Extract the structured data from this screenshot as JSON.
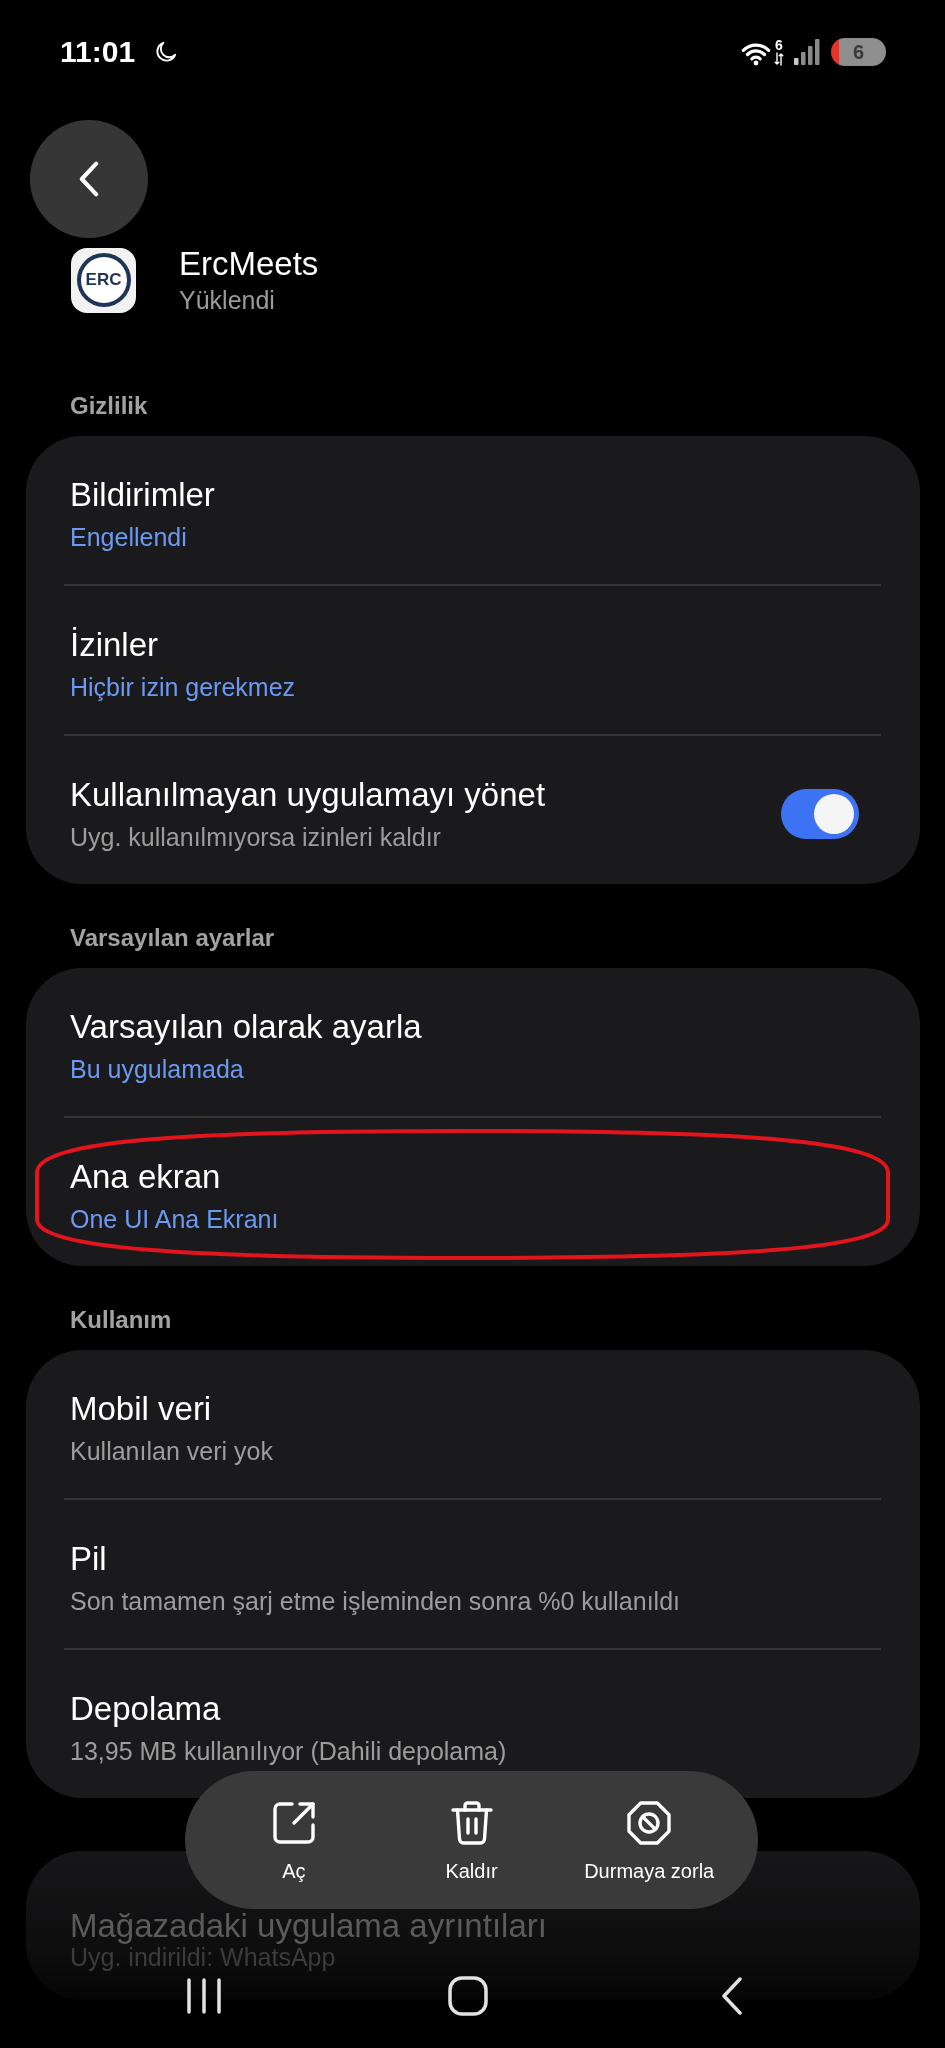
{
  "status_bar": {
    "time": "11:01",
    "wifi_standard": "6",
    "battery": "6"
  },
  "header": {
    "app_name": "ErcMeets",
    "app_status": "Yüklendi",
    "logo_text": "ERC"
  },
  "sections": [
    {
      "title": "Gizlilik",
      "faded": false,
      "items": [
        {
          "kind": "link",
          "title": "Bildirimler",
          "subtitle": "Engellendi",
          "accent": true,
          "circled": false
        },
        {
          "kind": "link",
          "title": "İzinler",
          "subtitle": "Hiçbir izin gerekmez",
          "accent": true,
          "circled": false
        },
        {
          "kind": "toggle",
          "title": "Kullanılmayan uygulamayı yönet",
          "subtitle": "Uyg. kullanılmıyorsa izinleri kaldır",
          "accent": false,
          "circled": false,
          "on": true
        }
      ]
    },
    {
      "title": "Varsayılan ayarlar",
      "faded": false,
      "items": [
        {
          "kind": "link",
          "title": "Varsayılan olarak ayarla",
          "subtitle": "Bu uygulamada",
          "accent": true,
          "circled": false
        },
        {
          "kind": "link",
          "title": "Ana ekran",
          "subtitle": "One UI Ana Ekranı",
          "accent": true,
          "circled": true
        }
      ]
    },
    {
      "title": "Kullanım",
      "faded": false,
      "items": [
        {
          "kind": "link",
          "title": "Mobil veri",
          "subtitle": "Kullanılan veri yok",
          "accent": false,
          "circled": false
        },
        {
          "kind": "link",
          "title": "Pil",
          "subtitle": "Son tamamen şarj etme işleminden sonra %0 kullanıldı",
          "accent": false,
          "circled": false
        },
        {
          "kind": "link",
          "title": "Depolama",
          "subtitle": "13,95 MB kullanılıyor (Dahili depolama)",
          "accent": false,
          "circled": false
        }
      ]
    },
    {
      "faded": true,
      "items": [
        {
          "kind": "link",
          "title": "Mağazadaki uygulama ayrıntıları",
          "subtitle": "Uyg. indirildi: WhatsApp",
          "accent": false,
          "circled": false
        }
      ]
    }
  ],
  "action_bar": [
    {
      "kind": "open",
      "label": "Aç"
    },
    {
      "kind": "uninstall",
      "label": "Kaldır"
    },
    {
      "kind": "force_stop",
      "label": "Durmaya zorla"
    }
  ]
}
